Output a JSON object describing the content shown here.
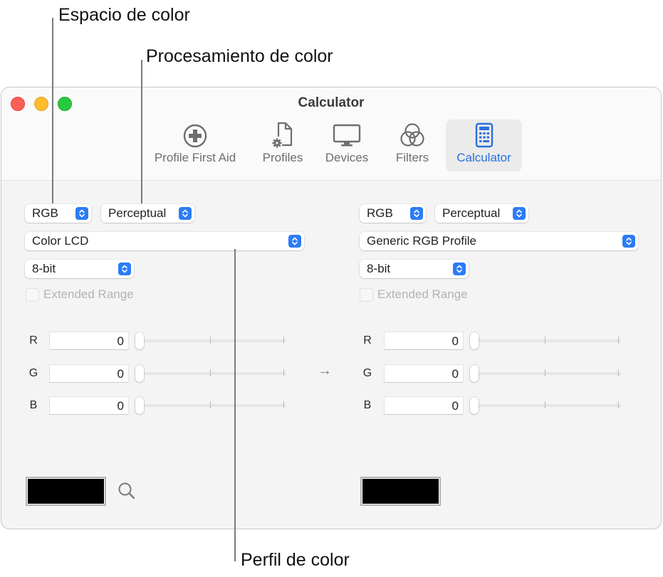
{
  "callouts": {
    "color_space": "Espacio de color",
    "color_processing": "Procesamiento de color",
    "color_profile": "Perfil de color"
  },
  "window": {
    "title": "Calculator",
    "traffic_lights": [
      "close",
      "minimize",
      "zoom"
    ]
  },
  "toolbar": {
    "items": [
      {
        "label": "Profile First Aid",
        "icon": "plus-circle-icon",
        "active": false
      },
      {
        "label": "Profiles",
        "icon": "document-gear-icon",
        "active": false
      },
      {
        "label": "Devices",
        "icon": "display-icon",
        "active": false
      },
      {
        "label": "Filters",
        "icon": "filters-circles-icon",
        "active": false
      },
      {
        "label": "Calculator",
        "icon": "calculator-icon",
        "active": true
      }
    ],
    "accent_color": "#2a6fe0"
  },
  "source": {
    "color_space": "RGB",
    "rendering_intent": "Perceptual",
    "profile": "Color LCD",
    "bit_depth": "8-bit",
    "extended_range_label": "Extended Range",
    "extended_range_checked": false,
    "channels": [
      {
        "label": "R",
        "value": "0",
        "slider_fraction": 0
      },
      {
        "label": "G",
        "value": "0",
        "slider_fraction": 0
      },
      {
        "label": "B",
        "value": "0",
        "slider_fraction": 0
      }
    ],
    "swatch_color": "#000000"
  },
  "conversion_arrow": "→",
  "destination": {
    "color_space": "RGB",
    "rendering_intent": "Perceptual",
    "profile": "Generic RGB Profile",
    "bit_depth": "8-bit",
    "extended_range_label": "Extended Range",
    "extended_range_checked": false,
    "channels": [
      {
        "label": "R",
        "value": "0",
        "slider_fraction": 0
      },
      {
        "label": "G",
        "value": "0",
        "slider_fraction": 0
      },
      {
        "label": "B",
        "value": "0",
        "slider_fraction": 0
      }
    ],
    "swatch_color": "#000000"
  }
}
